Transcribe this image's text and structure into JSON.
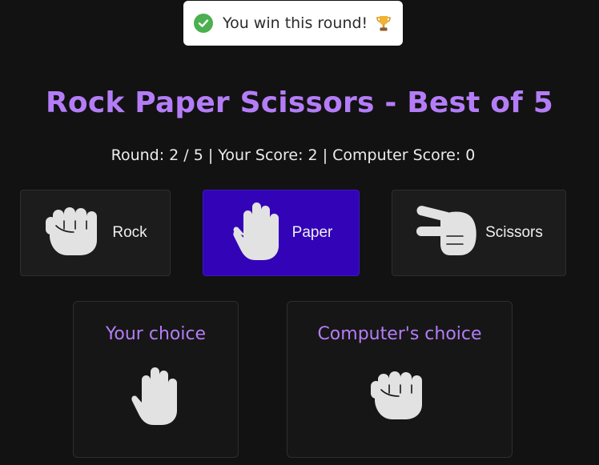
{
  "toast": {
    "message": "You win this round!",
    "status_color": "#4caf50",
    "icons": [
      "check-circle-icon",
      "trophy-icon"
    ]
  },
  "game": {
    "title": "Rock Paper Scissors - Best of 5",
    "status_line": "Round: 2 / 5 | Your Score: 2 | Computer Score: 0",
    "round": 2,
    "total_rounds": 5,
    "your_score": 2,
    "computer_score": 0
  },
  "choices": [
    {
      "id": "rock",
      "label": "Rock",
      "icon": "fist-icon",
      "selected": false
    },
    {
      "id": "paper",
      "label": "Paper",
      "icon": "open-hand-icon",
      "selected": true
    },
    {
      "id": "scissors",
      "label": "Scissors",
      "icon": "scissors-hand-icon",
      "selected": false
    }
  ],
  "results": {
    "player": {
      "title": "Your choice",
      "choice": "paper",
      "icon": "open-hand-icon"
    },
    "computer": {
      "title": "Computer's choice",
      "choice": "rock",
      "icon": "fist-icon"
    }
  },
  "colors": {
    "background": "#121212",
    "accent": "#b47df7",
    "selected": "#3303b8",
    "card": "#1c1c1c",
    "hand": "#e2e2e2"
  }
}
